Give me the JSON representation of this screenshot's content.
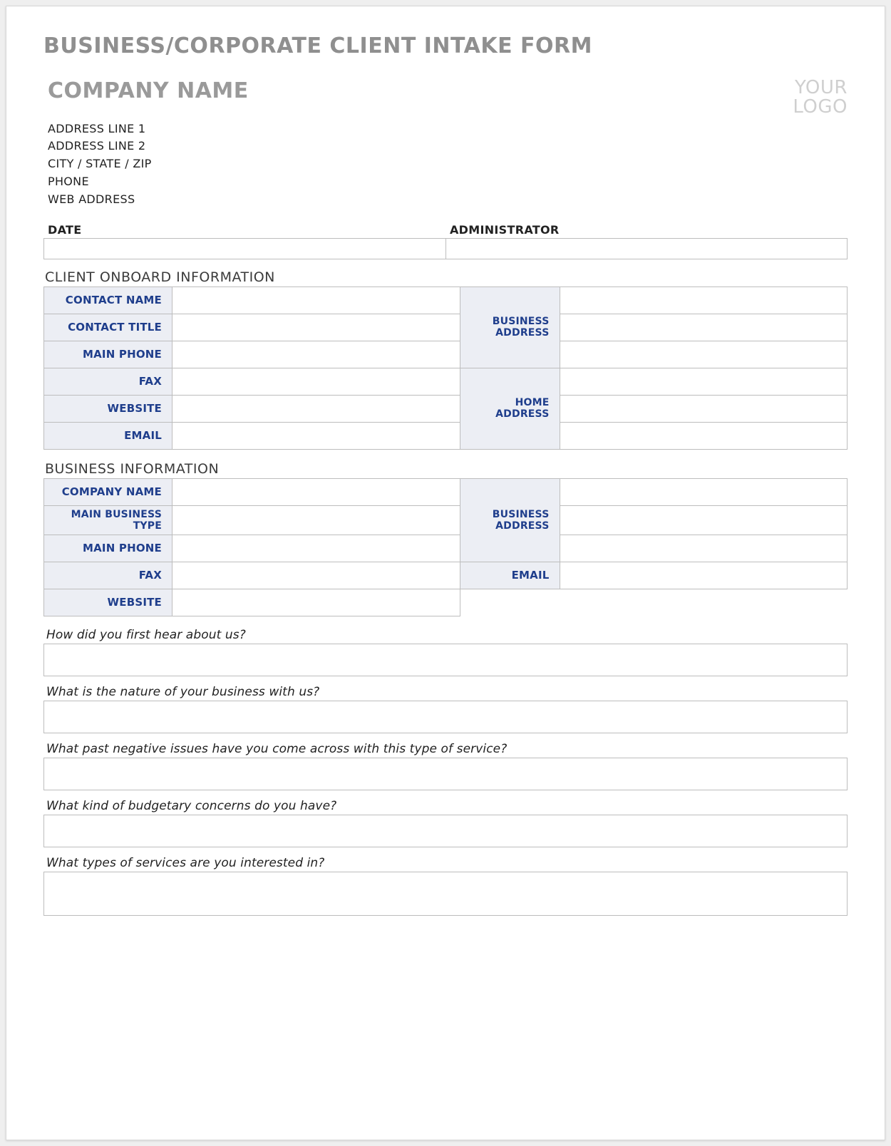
{
  "title": "BUSINESS/CORPORATE CLIENT INTAKE FORM",
  "header": {
    "company_name": "COMPANY NAME",
    "logo_line1": "YOUR",
    "logo_line2": "LOGO",
    "address_line1": "ADDRESS LINE 1",
    "address_line2": "ADDRESS LINE 2",
    "city_state_zip": "CITY / STATE / ZIP",
    "phone": "PHONE",
    "web": "WEB ADDRESS"
  },
  "da": {
    "date_label": "DATE",
    "date_value": "",
    "admin_label": "ADMINISTRATOR",
    "admin_value": ""
  },
  "sections": {
    "client_info_title": "CLIENT ONBOARD INFORMATION",
    "business_info_title": "BUSINESS INFORMATION"
  },
  "client": {
    "contact_name_lbl": "CONTACT NAME",
    "contact_title_lbl": "CONTACT TITLE",
    "main_phone_lbl": "MAIN PHONE",
    "fax_lbl": "FAX",
    "website_lbl": "WEBSITE",
    "email_lbl": "EMAIL",
    "business_addr_lbl": "BUSINESS ADDRESS",
    "home_addr_lbl": "HOME ADDRESS",
    "contact_name": "",
    "contact_title": "",
    "main_phone": "",
    "fax": "",
    "website": "",
    "email": "",
    "business_addr1": "",
    "business_addr2": "",
    "business_addr3": "",
    "home_addr1": "",
    "home_addr2": "",
    "home_addr3": ""
  },
  "business": {
    "company_name_lbl": "COMPANY NAME",
    "main_business_type_lbl": "MAIN BUSINESS TYPE",
    "main_phone_lbl": "MAIN PHONE",
    "fax_lbl": "FAX",
    "website_lbl": "WEBSITE",
    "business_addr_lbl": "BUSINESS ADDRESS",
    "email_lbl": "EMAIL",
    "company_name": "",
    "main_business_type": "",
    "main_phone": "",
    "fax": "",
    "website": "",
    "business_addr1": "",
    "business_addr2": "",
    "business_addr3": "",
    "email": ""
  },
  "questions": {
    "q1_label": "How did you first hear about us?",
    "q2_label": "What is the nature of your business with us?",
    "q3_label": "What past negative issues have you come across with this type of service?",
    "q4_label": "What kind of budgetary concerns do you have?",
    "q5_label": "What types of services are you interested in?",
    "q1": "",
    "q2": "",
    "q3": "",
    "q4": "",
    "q5": ""
  }
}
